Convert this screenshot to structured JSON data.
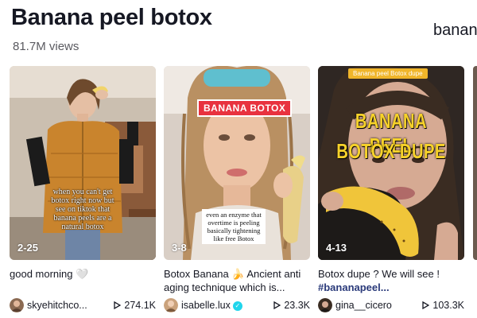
{
  "header": {
    "title": "Banana peel botox",
    "views": "81.7M views",
    "next_title": "banan"
  },
  "videos": [
    {
      "date": "2-25",
      "overlay_text": "when you can't get\nbotox right now but\nsee on tiktok that\nbanana peels are a\nnatural botox",
      "description": "good morning",
      "description_emoji": "🤍",
      "author": "skyehitchco...",
      "plays": "274.1K"
    },
    {
      "date": "3-8",
      "overlay_tag": "BANANA BOTOX",
      "overlay_text": "even an enzyme that\novertime is peeling\nbasically tightening\nlike free Botox",
      "description": "Botox Banana 🍌 Ancient anti aging technique which is...",
      "author": "isabelle.lux",
      "verified": true,
      "plays": "23.3K"
    },
    {
      "date": "4-13",
      "overlay_tag": "Banana peel Botox dupe",
      "overlay_line1": "BANANA PEEL",
      "overlay_line2": "BOTOX DUPE",
      "description": "Botox dupe ? We will see !",
      "hashtag": "#bananapeel...",
      "author": "gina__cicero",
      "plays": "103.3K"
    }
  ],
  "colors": {
    "text": "#161823",
    "secondary": "#5a5a60",
    "verified": "#20d5ec",
    "tag_red": "#e8323f",
    "tag_yellow": "#f0b52a",
    "overlay_yellow": "#f7d22a"
  }
}
